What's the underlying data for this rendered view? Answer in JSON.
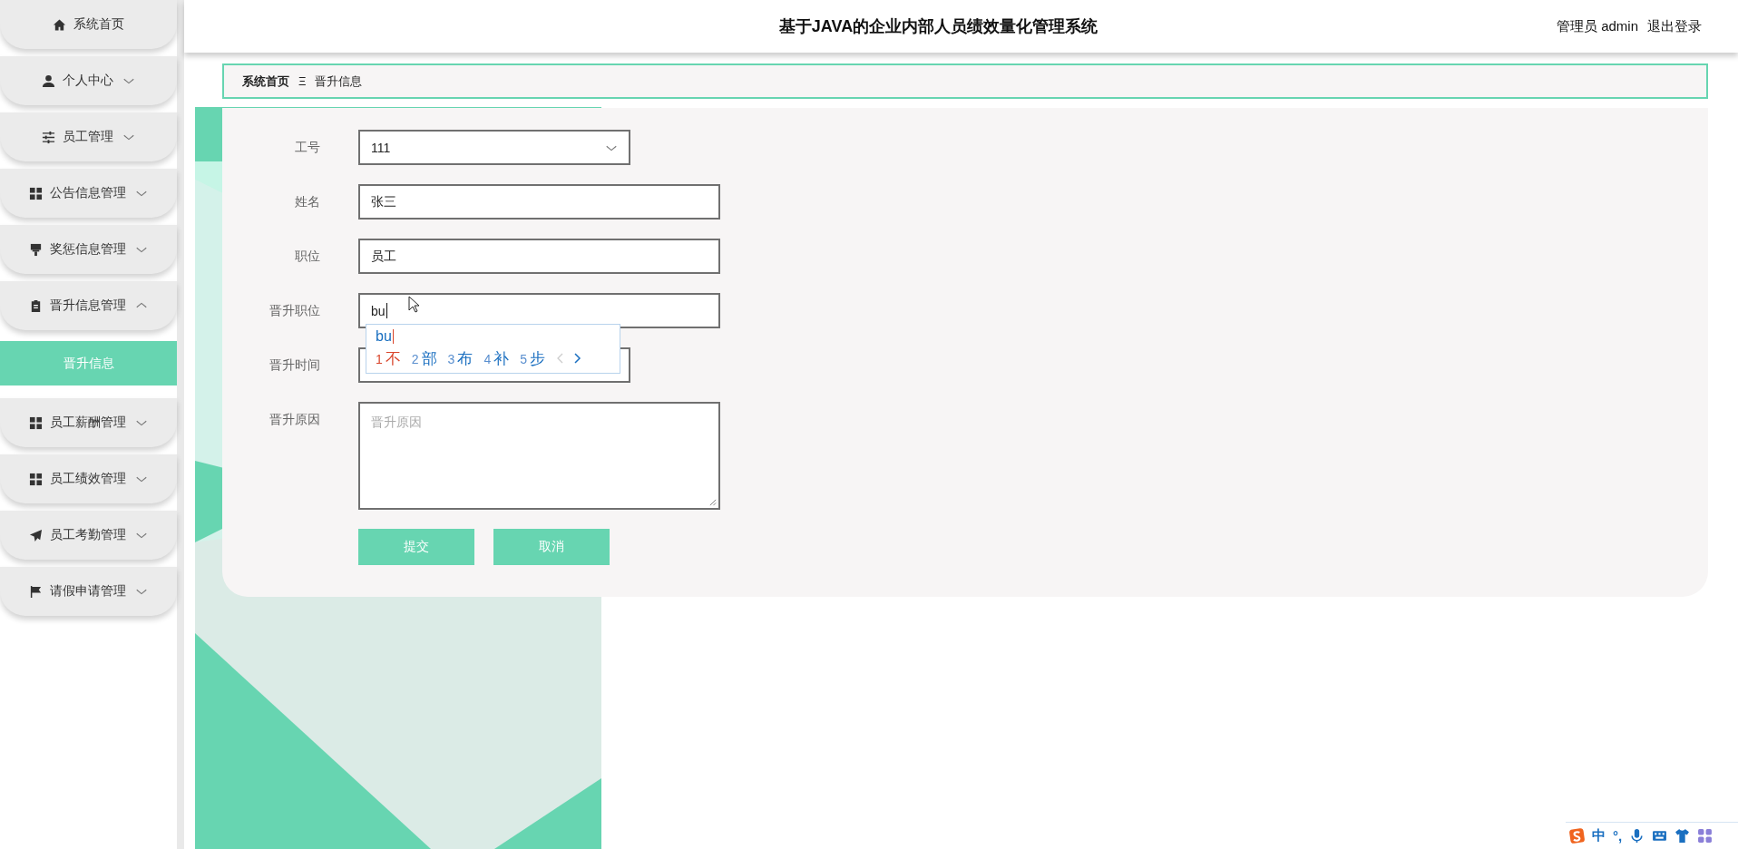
{
  "sidebar": {
    "items": [
      {
        "label": "系统首页",
        "kind": "link"
      },
      {
        "label": "个人中心",
        "kind": "menu",
        "expanded": false
      },
      {
        "label": "员工管理",
        "kind": "menu",
        "expanded": false
      },
      {
        "label": "公告信息管理",
        "kind": "menu",
        "expanded": false
      },
      {
        "label": "奖惩信息管理",
        "kind": "menu",
        "expanded": false
      },
      {
        "label": "晋升信息管理",
        "kind": "menu",
        "expanded": true,
        "children": [
          {
            "label": "晋升信息",
            "selected": true
          }
        ]
      },
      {
        "label": "员工薪酬管理",
        "kind": "menu",
        "expanded": false
      },
      {
        "label": "员工绩效管理",
        "kind": "menu",
        "expanded": false
      },
      {
        "label": "员工考勤管理",
        "kind": "menu",
        "expanded": false
      },
      {
        "label": "请假申请管理",
        "kind": "menu",
        "expanded": false
      }
    ]
  },
  "header": {
    "title": "基于JAVA的企业内部人员绩效量化管理系统",
    "user": "管理员 admin",
    "logout": "退出登录"
  },
  "breadcrumb": {
    "items": [
      "系统首页",
      "晋升信息"
    ],
    "separator": "Ξ"
  },
  "form": {
    "fields": [
      {
        "label": "工号",
        "kind": "select",
        "value": "111"
      },
      {
        "label": "姓名",
        "kind": "text",
        "value": "张三"
      },
      {
        "label": "职位",
        "kind": "text",
        "value": "员工"
      },
      {
        "label": "晋升职位",
        "kind": "text",
        "value": "bu",
        "focused": true
      },
      {
        "label": "晋升时间",
        "kind": "date"
      },
      {
        "label": "晋升原因",
        "kind": "textarea",
        "placeholder": "晋升原因"
      }
    ],
    "buttons": [
      "提交",
      "取消"
    ]
  },
  "ime": {
    "composition": "bu",
    "candidates": [
      {
        "number": "1",
        "text": "不",
        "selected": true
      },
      {
        "number": "2",
        "text": "部",
        "selected": false
      },
      {
        "number": "3",
        "text": "布",
        "selected": false
      },
      {
        "number": "4",
        "text": "补",
        "selected": false
      },
      {
        "number": "5",
        "text": "步",
        "selected": false
      }
    ]
  },
  "ime_toolbar": {
    "mode": "中",
    "punctuation": "°,"
  }
}
